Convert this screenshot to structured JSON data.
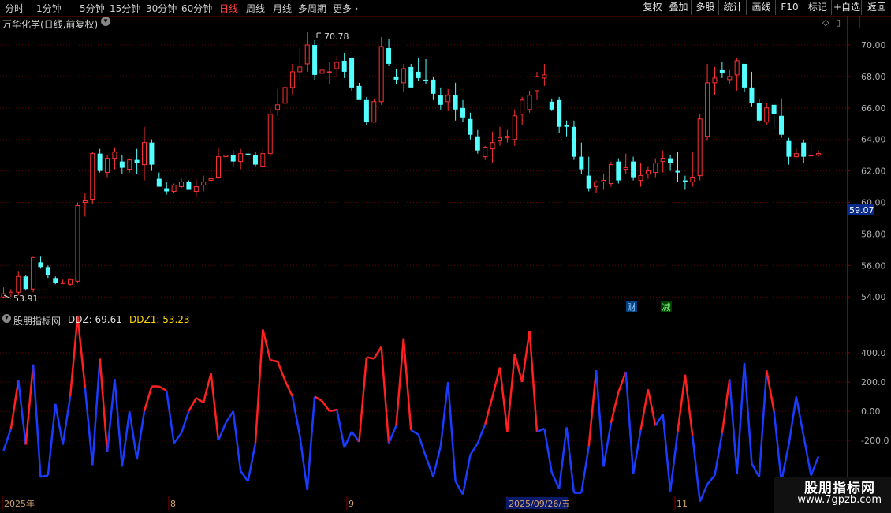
{
  "toolbar": {
    "periods": [
      "分时",
      "1分钟",
      "5分钟",
      "15分钟",
      "30分钟",
      "60分钟",
      "日线",
      "周线",
      "月线",
      "多周期",
      "更多"
    ],
    "active": "日线",
    "right_buttons": [
      "复权",
      "叠加",
      "多股",
      "统计",
      "画线",
      "F10",
      "标记",
      "+自选",
      "返回"
    ]
  },
  "main": {
    "title": "万华化学(日线,前复权)",
    "high_label": "70.78",
    "low_label": "53.91",
    "price_tag": "59.07",
    "y_ticks": [
      "70.00",
      "68.00",
      "66.00",
      "64.00",
      "62.00",
      "60.00",
      "58.00",
      "56.00",
      "54.00"
    ],
    "markers": {
      "cai": "财",
      "jian": "减"
    }
  },
  "indicator": {
    "name": "股朋指标网",
    "ddz_label": "DDZ: 69.61",
    "ddz1_label": "DDZ1: 53.23",
    "y_ticks": [
      "400.0",
      "200.0",
      "0.00",
      "-200.0"
    ]
  },
  "xaxis": {
    "labels": [
      "2025年",
      "8",
      "9",
      "2025/09/26/五",
      "11"
    ]
  },
  "watermark": {
    "line1": "股朋指标网",
    "line2": "www.7gpzb.com"
  },
  "colors": {
    "up": "#ff3232",
    "down": "#54ffff",
    "ddz_up": "#ff2020",
    "ddz_down": "#1a3cff",
    "axis": "#8b0000"
  },
  "chart_data": {
    "type": "candlestick",
    "candles": [
      [
        54.0,
        54.6,
        53.9,
        54.2
      ],
      [
        54.2,
        54.5,
        54.0,
        54.3
      ],
      [
        54.3,
        55.6,
        54.1,
        55.3
      ],
      [
        55.3,
        55.4,
        54.4,
        54.5
      ],
      [
        54.5,
        56.6,
        54.3,
        56.5
      ],
      [
        56.2,
        56.6,
        55.8,
        55.9
      ],
      [
        55.9,
        56.0,
        55.2,
        55.4
      ],
      [
        55.2,
        55.3,
        54.8,
        54.9
      ],
      [
        54.9,
        55.1,
        54.8,
        54.9
      ],
      [
        54.8,
        55.2,
        54.7,
        55.1
      ],
      [
        55.0,
        60.0,
        54.9,
        59.8
      ],
      [
        60.0,
        60.6,
        59.1,
        60.1
      ],
      [
        60.2,
        63.2,
        59.9,
        63.1
      ],
      [
        63.1,
        63.4,
        61.9,
        62.0
      ],
      [
        61.9,
        63.0,
        61.6,
        62.8
      ],
      [
        62.8,
        63.5,
        62.1,
        63.2
      ],
      [
        62.6,
        63.0,
        61.8,
        62.2
      ],
      [
        62.1,
        62.8,
        61.9,
        62.7
      ],
      [
        62.7,
        63.4,
        61.8,
        62.5
      ],
      [
        62.4,
        64.8,
        61.4,
        63.8
      ],
      [
        63.8,
        64.0,
        62.0,
        62.4
      ],
      [
        61.5,
        61.9,
        61.1,
        61.0
      ],
      [
        60.9,
        61.3,
        60.5,
        60.7
      ],
      [
        60.7,
        61.2,
        60.6,
        61.1
      ],
      [
        61.0,
        61.5,
        60.9,
        61.3
      ],
      [
        61.3,
        61.4,
        60.8,
        60.8
      ],
      [
        60.7,
        61.5,
        60.3,
        61.0
      ],
      [
        61.1,
        61.7,
        60.7,
        61.3
      ],
      [
        61.4,
        62.6,
        61.1,
        61.5
      ],
      [
        61.6,
        63.5,
        61.5,
        62.9
      ],
      [
        62.9,
        63.0,
        62.6,
        63.0
      ],
      [
        63.0,
        63.3,
        62.3,
        62.6
      ],
      [
        62.6,
        63.4,
        62.1,
        63.1
      ],
      [
        63.1,
        63.3,
        62.0,
        63.0
      ],
      [
        63.0,
        63.2,
        62.3,
        62.4
      ],
      [
        62.3,
        63.5,
        62.2,
        63.1
      ],
      [
        63.1,
        66.0,
        62.9,
        65.6
      ],
      [
        65.9,
        67.2,
        65.5,
        66.2
      ],
      [
        66.3,
        67.4,
        66.0,
        67.3
      ],
      [
        67.3,
        68.8,
        66.8,
        68.3
      ],
      [
        68.3,
        69.8,
        67.7,
        68.6
      ],
      [
        68.8,
        70.8,
        68.3,
        70.0
      ],
      [
        70.0,
        70.3,
        67.8,
        68.1
      ],
      [
        68.2,
        69.2,
        66.6,
        68.4
      ],
      [
        68.3,
        68.9,
        67.5,
        68.3
      ],
      [
        68.5,
        69.3,
        68.0,
        68.9
      ],
      [
        69.0,
        69.5,
        67.9,
        68.3
      ],
      [
        69.2,
        69.2,
        67.1,
        67.3
      ],
      [
        67.4,
        67.6,
        66.6,
        66.5
      ],
      [
        66.5,
        66.7,
        64.9,
        65.1
      ],
      [
        65.1,
        66.6,
        65.1,
        66.4
      ],
      [
        66.4,
        70.5,
        66.2,
        69.9
      ],
      [
        69.8,
        70.4,
        68.7,
        68.8
      ],
      [
        68.0,
        68.5,
        67.5,
        67.8
      ],
      [
        67.6,
        68.8,
        67.0,
        68.5
      ],
      [
        68.6,
        68.8,
        67.5,
        67.3
      ],
      [
        68.3,
        69.2,
        67.7,
        67.9
      ],
      [
        67.8,
        69.1,
        67.5,
        67.7
      ],
      [
        67.8,
        68.0,
        66.5,
        66.9
      ],
      [
        66.8,
        67.3,
        65.9,
        66.2
      ],
      [
        66.4,
        67.2,
        65.8,
        66.8
      ],
      [
        66.8,
        67.6,
        65.2,
        65.9
      ],
      [
        66.0,
        66.5,
        65.1,
        65.4
      ],
      [
        65.3,
        65.7,
        64.0,
        64.3
      ],
      [
        64.2,
        64.6,
        63.1,
        63.3
      ],
      [
        62.9,
        63.6,
        62.7,
        63.5
      ],
      [
        63.4,
        64.5,
        62.5,
        63.8
      ],
      [
        63.9,
        64.8,
        63.6,
        64.1
      ],
      [
        64.1,
        64.6,
        63.8,
        64.2
      ],
      [
        64.0,
        65.9,
        63.6,
        65.5
      ],
      [
        65.6,
        66.7,
        64.9,
        66.5
      ],
      [
        65.9,
        67.1,
        65.7,
        66.8
      ],
      [
        67.1,
        68.3,
        66.5,
        68.0
      ],
      [
        67.9,
        68.8,
        67.4,
        68.1
      ],
      [
        66.4,
        66.6,
        65.8,
        65.9
      ],
      [
        66.5,
        66.7,
        64.4,
        64.8
      ],
      [
        64.9,
        65.2,
        64.2,
        64.8
      ],
      [
        64.8,
        65.2,
        62.7,
        62.9
      ],
      [
        62.9,
        63.8,
        61.8,
        62.1
      ],
      [
        61.7,
        62.9,
        60.7,
        60.9
      ],
      [
        61.0,
        61.4,
        60.6,
        61.3
      ],
      [
        61.3,
        61.8,
        60.8,
        61.4
      ],
      [
        61.2,
        62.6,
        61.0,
        62.4
      ],
      [
        62.6,
        62.8,
        61.2,
        61.4
      ],
      [
        62.1,
        63.1,
        61.8,
        62.2
      ],
      [
        62.6,
        62.9,
        61.4,
        61.6
      ],
      [
        61.4,
        62.5,
        61.0,
        61.7
      ],
      [
        61.8,
        62.3,
        61.5,
        62.0
      ],
      [
        61.9,
        62.8,
        61.6,
        62.5
      ],
      [
        62.6,
        63.3,
        61.9,
        62.8
      ],
      [
        62.8,
        63.0,
        62.0,
        62.5
      ],
      [
        62.0,
        63.2,
        61.3,
        61.9
      ],
      [
        61.4,
        61.7,
        60.8,
        61.3
      ],
      [
        61.3,
        63.2,
        61.0,
        61.6
      ],
      [
        61.7,
        65.6,
        61.4,
        65.3
      ],
      [
        64.2,
        68.8,
        63.9,
        67.6
      ],
      [
        67.6,
        68.6,
        66.8,
        67.9
      ],
      [
        68.4,
        68.9,
        67.9,
        68.2
      ],
      [
        67.8,
        68.4,
        67.5,
        68.0
      ],
      [
        68.1,
        69.2,
        67.1,
        69.0
      ],
      [
        68.8,
        68.6,
        67.0,
        67.3
      ],
      [
        67.3,
        68.3,
        66.1,
        66.3
      ],
      [
        66.3,
        66.6,
        65.1,
        65.2
      ],
      [
        65.1,
        66.3,
        64.9,
        66.0
      ],
      [
        66.2,
        66.3,
        64.7,
        65.6
      ],
      [
        65.5,
        66.6,
        64.1,
        64.3
      ],
      [
        63.9,
        64.1,
        62.4,
        62.9
      ],
      [
        62.9,
        63.4,
        62.8,
        63.1
      ],
      [
        63.8,
        64.0,
        62.5,
        62.9
      ],
      [
        63.0,
        63.6,
        62.9,
        63.0
      ],
      [
        63.0,
        63.3,
        62.9,
        63.1
      ]
    ],
    "ddz": [
      -270,
      -120,
      210,
      -230,
      320,
      -450,
      -440,
      50,
      -230,
      100,
      650,
      160,
      -370,
      360,
      -280,
      220,
      -380,
      0,
      -330,
      0,
      170,
      170,
      140,
      -220,
      -150,
      0,
      90,
      60,
      260,
      -200,
      -80,
      0,
      -410,
      -480,
      -220,
      560,
      350,
      340,
      210,
      100,
      -170,
      -540,
      100,
      70,
      0,
      10,
      -250,
      -140,
      -210,
      370,
      360,
      440,
      -220,
      -100,
      500,
      -130,
      -160,
      -310,
      -450,
      -240,
      200,
      -480,
      -570,
      -300,
      -220,
      -90,
      100,
      300,
      -140,
      390,
      200,
      550,
      -140,
      -120,
      -420,
      -530,
      -110,
      -560,
      -560,
      -240,
      280,
      -380,
      -80,
      130,
      270,
      -430,
      -130,
      150,
      -100,
      -20,
      -550,
      -140,
      250,
      -170,
      -620,
      -500,
      -440,
      -150,
      220,
      -430,
      330,
      -360,
      -450,
      280,
      0,
      -480,
      -230,
      100,
      -170,
      -440,
      -310
    ]
  }
}
